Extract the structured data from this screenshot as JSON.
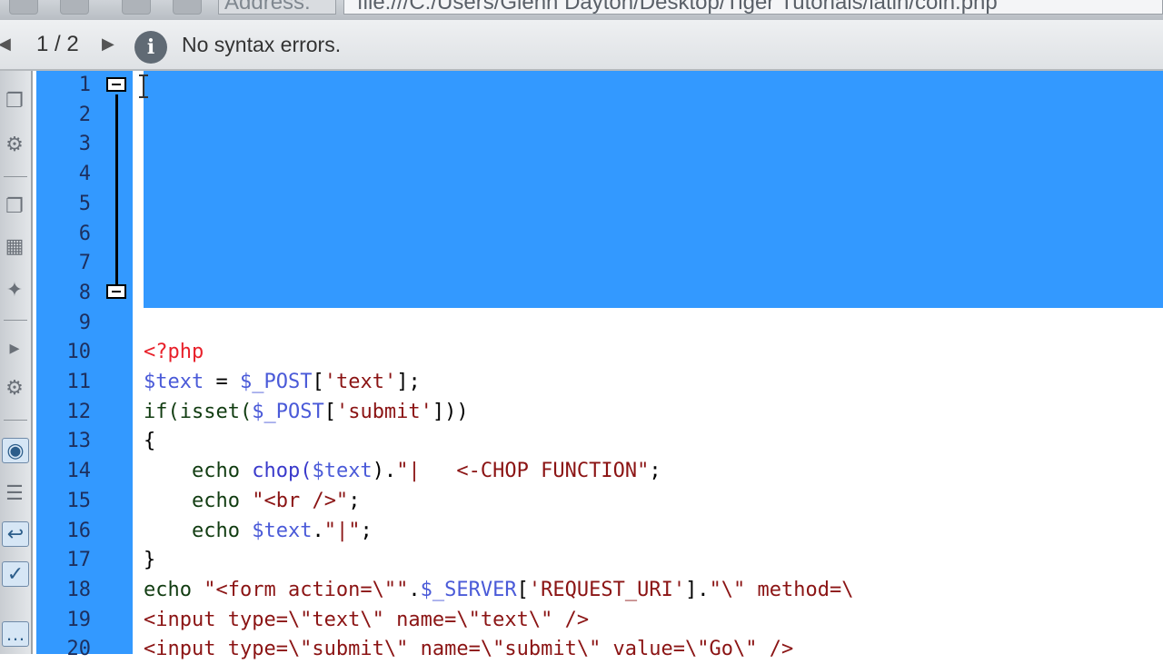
{
  "address_bar": {
    "label": "Address:",
    "url": "file:///C:/Users/Glenn Dayton/Desktop/Tiger Tutorials/latin/coin.php"
  },
  "status_bar": {
    "prev_arrow": "◀",
    "counter": "1 / 2",
    "next_arrow": "▶",
    "info_icon": "i",
    "message": "No syntax errors."
  },
  "gutter": {
    "line_numbers": [
      "1",
      "2",
      "3",
      "4",
      "5",
      "6",
      "7",
      "8",
      "9",
      "10",
      "11",
      "12",
      "13",
      "14",
      "15",
      "16",
      "17",
      "18",
      "19",
      "20"
    ]
  },
  "code_lines": [
    {
      "n": 10,
      "segments": [
        {
          "t": "<?php",
          "c": "k-php"
        }
      ]
    },
    {
      "n": 11,
      "segments": [
        {
          "t": "$text",
          "c": "k-var"
        },
        {
          "t": " = ",
          "c": "k-punc"
        },
        {
          "t": "$_POST",
          "c": "k-var"
        },
        {
          "t": "[",
          "c": "k-punc"
        },
        {
          "t": "'text'",
          "c": "k-str"
        },
        {
          "t": "];",
          "c": "k-punc"
        }
      ]
    },
    {
      "n": 12,
      "segments": [
        {
          "t": "if(isset(",
          "c": "k-fn"
        },
        {
          "t": "$_POST",
          "c": "k-var"
        },
        {
          "t": "[",
          "c": "k-punc"
        },
        {
          "t": "'submit'",
          "c": "k-str"
        },
        {
          "t": "]))",
          "c": "k-punc"
        }
      ]
    },
    {
      "n": 13,
      "segments": [
        {
          "t": "{",
          "c": "k-punc"
        }
      ]
    },
    {
      "n": 14,
      "segments": [
        {
          "t": "    echo ",
          "c": "k-fn"
        },
        {
          "t": "chop(",
          "c": "k-blue"
        },
        {
          "t": "$text",
          "c": "k-var"
        },
        {
          "t": ").",
          "c": "k-punc"
        },
        {
          "t": "\"|   <-CHOP FUNCTION\"",
          "c": "k-str"
        },
        {
          "t": ";",
          "c": "k-punc"
        }
      ]
    },
    {
      "n": 15,
      "segments": [
        {
          "t": "    echo ",
          "c": "k-fn"
        },
        {
          "t": "\"<br />\"",
          "c": "k-str"
        },
        {
          "t": ";",
          "c": "k-punc"
        }
      ]
    },
    {
      "n": 16,
      "segments": [
        {
          "t": "    echo ",
          "c": "k-fn"
        },
        {
          "t": "$text",
          "c": "k-var"
        },
        {
          "t": ".",
          "c": "k-punc"
        },
        {
          "t": "\"|\"",
          "c": "k-str"
        },
        {
          "t": ";",
          "c": "k-punc"
        }
      ]
    },
    {
      "n": 17,
      "segments": [
        {
          "t": "}",
          "c": "k-punc"
        }
      ]
    },
    {
      "n": 18,
      "segments": [
        {
          "t": "echo ",
          "c": "k-fn"
        },
        {
          "t": "\"<form action=\\\"\"",
          "c": "k-str"
        },
        {
          "t": ".",
          "c": "k-punc"
        },
        {
          "t": "$_SERVER",
          "c": "k-var"
        },
        {
          "t": "[",
          "c": "k-punc"
        },
        {
          "t": "'REQUEST_URI'",
          "c": "k-str"
        },
        {
          "t": "].",
          "c": "k-punc"
        },
        {
          "t": "\"\\\" method=\\",
          "c": "k-str"
        }
      ]
    },
    {
      "n": 19,
      "segments": [
        {
          "t": "<input type=\\\"text\\\" name=\\\"text\\\" />",
          "c": "k-str"
        }
      ]
    },
    {
      "n": 20,
      "segments": [
        {
          "t": "<input type=\\\"submit\\\" name=\\\"submit\\\" value=\\\"Go\\\" />",
          "c": "k-str"
        }
      ]
    }
  ],
  "colors": {
    "selection": "#3399ff",
    "php_tag": "#e8202a",
    "variable": "#4a5ad8",
    "keyword": "#113c11",
    "string": "#8b1414"
  },
  "icons": {
    "sidebar": [
      "file-icon",
      "gear-icon",
      "snippet-icon",
      "grid-icon",
      "wand-icon",
      "tag-icon",
      "settings-icon",
      "preview-icon",
      "tree-icon",
      "wrap-icon",
      "validate-icon",
      "comment-icon"
    ]
  }
}
